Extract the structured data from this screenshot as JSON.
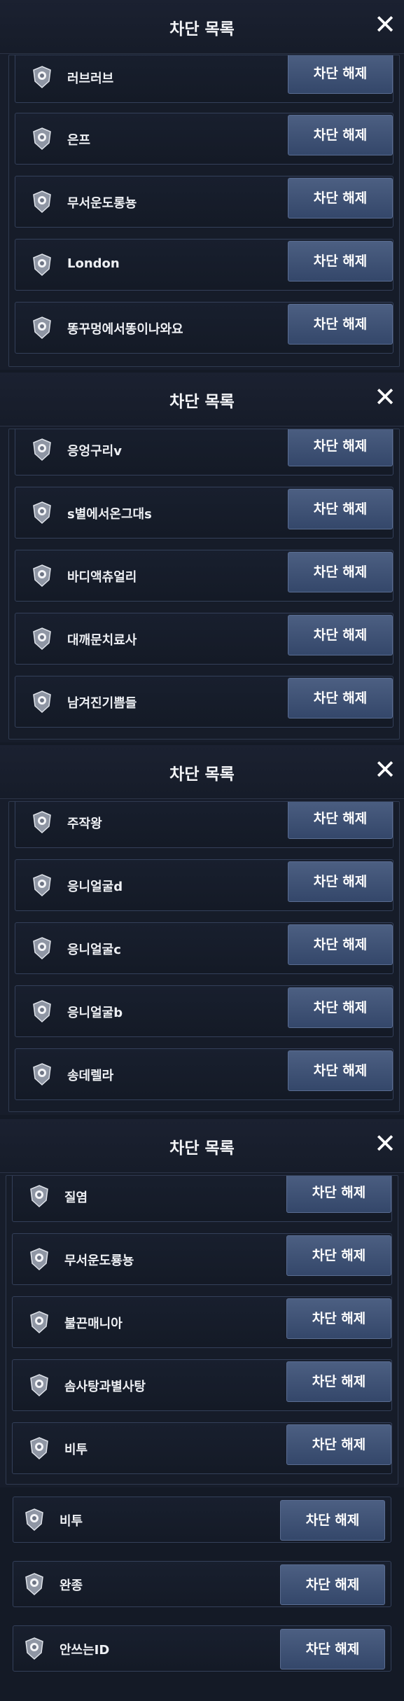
{
  "panels": [
    {
      "title": "차단 목록",
      "close_icon": "close-icon",
      "rows": [
        {
          "name": "러브러브",
          "button": "차단 해제"
        },
        {
          "name": "은프",
          "button": "차단 해제"
        },
        {
          "name": "무서운도롱뇽",
          "button": "차단 해제"
        },
        {
          "name": "London",
          "button": "차단 해제"
        },
        {
          "name": "똥꾸멍에서똥이나와요",
          "button": "차단 해제"
        }
      ]
    },
    {
      "title": "차단 목록",
      "close_icon": "close-icon",
      "rows": [
        {
          "name": "응엉구리v",
          "button": "차단 해제"
        },
        {
          "name": "s별에서온그대s",
          "button": "차단 해제"
        },
        {
          "name": "바디액츄얼리",
          "button": "차단 해제"
        },
        {
          "name": "대깨문치료사",
          "button": "차단 해제"
        },
        {
          "name": "남겨진기쁨들",
          "button": "차단 해제"
        }
      ]
    },
    {
      "title": "차단 목록",
      "close_icon": "close-icon",
      "rows": [
        {
          "name": "주작왕",
          "button": "차단 해제"
        },
        {
          "name": "응니얼굴d",
          "button": "차단 해제"
        },
        {
          "name": "응니얼굴c",
          "button": "차단 해제"
        },
        {
          "name": "응니얼굴b",
          "button": "차단 해제"
        },
        {
          "name": "송데렐라",
          "button": "차단 해제"
        }
      ]
    },
    {
      "title": "차단 목록",
      "close_icon": "close-icon",
      "rows": [
        {
          "name": "질염",
          "button": "차단 해제"
        },
        {
          "name": "무서운도룡뇽",
          "button": "차단 해제"
        },
        {
          "name": "불끈매니아",
          "button": "차단 해제"
        },
        {
          "name": "솜사탕과별사탕",
          "button": "차단 해제"
        },
        {
          "name": "비투",
          "button": "차단 해제"
        }
      ]
    }
  ],
  "bottom_rows": [
    {
      "name": "비투",
      "button": "차단 해제"
    },
    {
      "name": "완종",
      "button": "차단 해제"
    },
    {
      "name": "안쓰는ID",
      "button": "차단 해제"
    }
  ],
  "icons": {
    "row_icon": "shield-emblem-icon",
    "close": "close-icon"
  },
  "colors": {
    "button": "#3f5276",
    "background": "#171d2b",
    "border": "#34405a"
  }
}
